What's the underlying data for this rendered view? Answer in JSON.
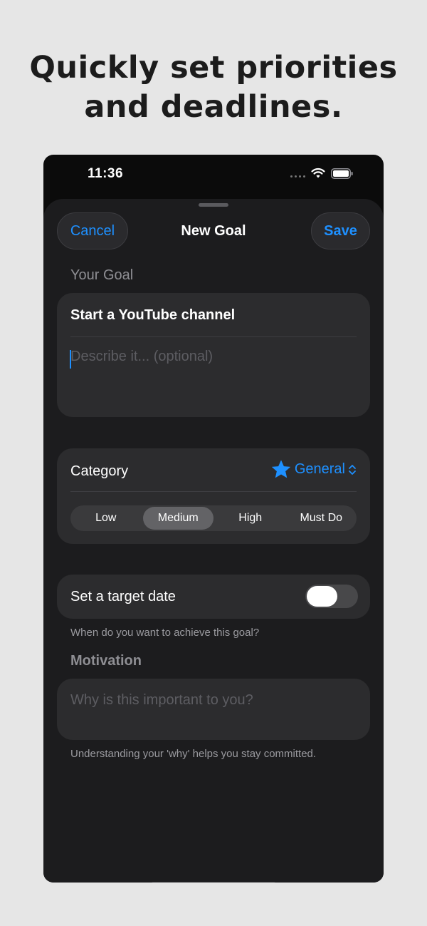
{
  "headline": {
    "line1": "Quickly set priorities",
    "line2": "and deadlines."
  },
  "status_bar": {
    "time": "11:36",
    "icons": [
      "signal-dots-icon",
      "wifi-icon",
      "battery-icon"
    ]
  },
  "sheet": {
    "cancel_label": "Cancel",
    "title": "New Goal",
    "save_label": "Save"
  },
  "goal_section": {
    "label": "Your Goal",
    "title_value": "Start a YouTube channel",
    "description_placeholder": "Describe it... (optional)"
  },
  "category": {
    "label": "Category",
    "icon": "star-icon",
    "value": "General",
    "priorities": [
      "Low",
      "Medium",
      "High",
      "Must Do"
    ],
    "selected_priority": "Medium"
  },
  "target_date": {
    "label": "Set a target date",
    "enabled": false,
    "footnote": "When do you want to achieve this goal?"
  },
  "motivation": {
    "label": "Motivation",
    "placeholder": "Why is this important to you?",
    "footnote": "Understanding your 'why' helps you stay committed."
  },
  "colors": {
    "accent": "#1e90ff",
    "sheet_bg": "#1c1c1e",
    "card_bg": "#2c2c2e",
    "page_bg": "#e6e6e6"
  }
}
